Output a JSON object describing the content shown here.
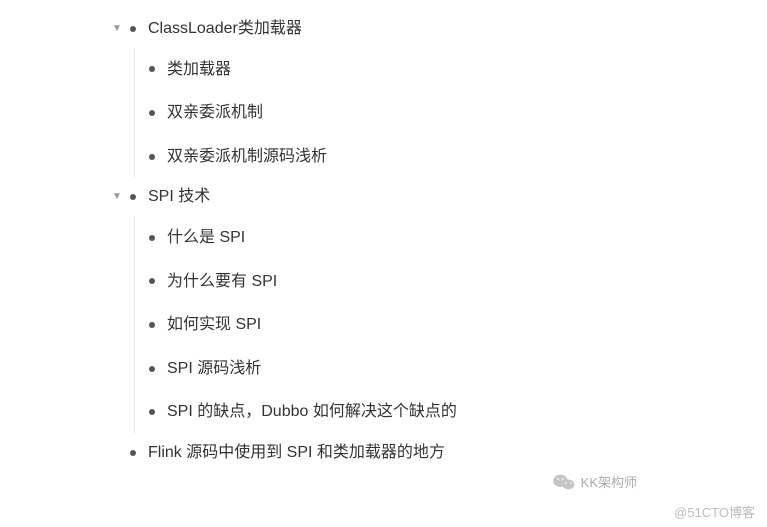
{
  "tree": {
    "nodes": [
      {
        "label": "ClassLoader类加载器",
        "expanded": true,
        "children": [
          {
            "label": "类加载器"
          },
          {
            "label": "双亲委派机制"
          },
          {
            "label": "双亲委派机制源码浅析"
          }
        ]
      },
      {
        "label": "SPI 技术",
        "expanded": true,
        "children": [
          {
            "label": "什么是 SPI"
          },
          {
            "label": "为什么要有 SPI"
          },
          {
            "label": "如何实现 SPI"
          },
          {
            "label": "SPI 源码浅析"
          },
          {
            "label": "SPI 的缺点，Dubbo 如何解决这个缺点的"
          }
        ]
      },
      {
        "label": "Flink 源码中使用到 SPI 和类加载器的地方",
        "expanded": false
      }
    ]
  },
  "watermarks": {
    "wechat_label": "KK架构师",
    "corner": "@51CTO博客"
  }
}
